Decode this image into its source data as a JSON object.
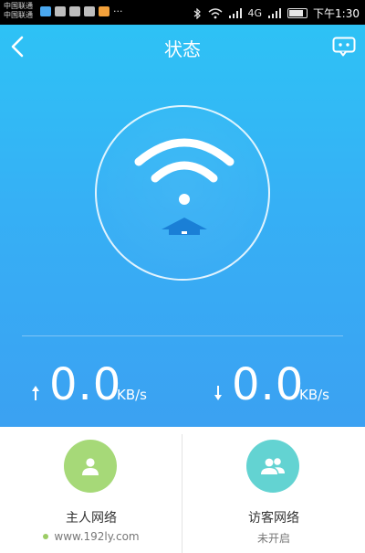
{
  "status_bar": {
    "carrier_line1": "中国联通",
    "carrier_line2": "中国联通",
    "overflow": "···",
    "network_small": "4G",
    "time": "下午1:30"
  },
  "header": {
    "title": "状态",
    "back_icon": "chevron-left-icon",
    "chat_icon": "chat-bubble-icon"
  },
  "router": {
    "wifi_icon": "wifi-icon",
    "home_icon": "home-icon"
  },
  "speed": {
    "upload_value": "0.0",
    "upload_unit": "KB/s",
    "download_value": "0.0",
    "download_unit": "KB/s"
  },
  "networks": {
    "host": {
      "label": "主人网络",
      "subtitle": "www.192ly.com",
      "icon": "person-icon",
      "color": "#a6d978"
    },
    "guest": {
      "label": "访客网络",
      "subtitle": "未开启",
      "icon": "group-icon",
      "color": "#63d3d2"
    }
  },
  "colors": {
    "accent_blue": "#36b0f5",
    "speed_text": "#ffffff"
  }
}
